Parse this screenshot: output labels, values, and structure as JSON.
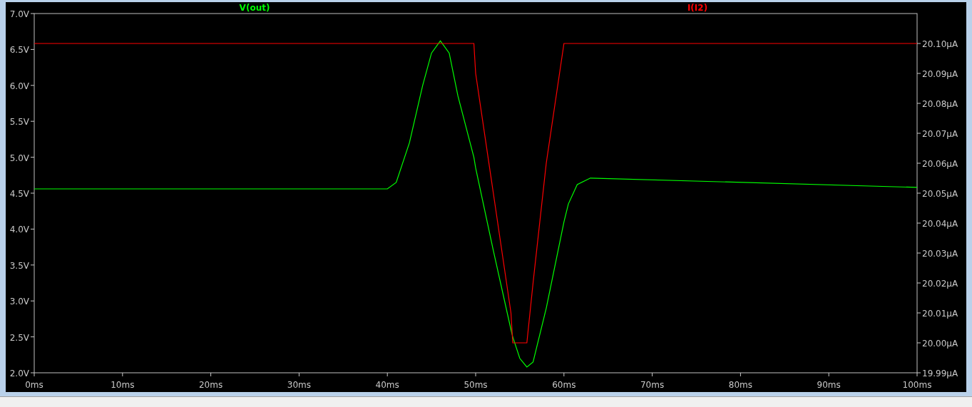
{
  "plot": {
    "chart_data": {
      "type": "line",
      "x": [
        0,
        40,
        41,
        42.5,
        44,
        45,
        46,
        47,
        48,
        49.8,
        50,
        52,
        54,
        54.2,
        55,
        55.8,
        56.5,
        58,
        59.5,
        60,
        60.5,
        61.5,
        63,
        100
      ],
      "xlim": [
        0,
        100
      ],
      "xticks": [
        {
          "value": 0,
          "label": "0ms"
        },
        {
          "value": 10,
          "label": "10ms"
        },
        {
          "value": 20,
          "label": "20ms"
        },
        {
          "value": 30,
          "label": "30ms"
        },
        {
          "value": 40,
          "label": "40ms"
        },
        {
          "value": 50,
          "label": "50ms"
        },
        {
          "value": 60,
          "label": "60ms"
        },
        {
          "value": 70,
          "label": "70ms"
        },
        {
          "value": 80,
          "label": "80ms"
        },
        {
          "value": 90,
          "label": "90ms"
        },
        {
          "value": 100,
          "label": "100ms"
        }
      ],
      "ylim": [
        2.0,
        7.0
      ],
      "yticks": [
        {
          "value": 2.0,
          "label": "2.0V"
        },
        {
          "value": 2.5,
          "label": "2.5V"
        },
        {
          "value": 3.0,
          "label": "3.0V"
        },
        {
          "value": 3.5,
          "label": "3.5V"
        },
        {
          "value": 4.0,
          "label": "4.0V"
        },
        {
          "value": 4.5,
          "label": "4.5V"
        },
        {
          "value": 5.0,
          "label": "5.0V"
        },
        {
          "value": 5.5,
          "label": "5.5V"
        },
        {
          "value": 6.0,
          "label": "6.0V"
        },
        {
          "value": 6.5,
          "label": "6.5V"
        },
        {
          "value": 7.0,
          "label": "7.0V"
        }
      ],
      "y2lim": [
        19.99,
        20.11
      ],
      "y2ticks": [
        {
          "value": 19.99,
          "label": "19.99µA"
        },
        {
          "value": 20.0,
          "label": "20.00µA"
        },
        {
          "value": 20.01,
          "label": "20.01µA"
        },
        {
          "value": 20.02,
          "label": "20.02µA"
        },
        {
          "value": 20.03,
          "label": "20.03µA"
        },
        {
          "value": 20.04,
          "label": "20.04µA"
        },
        {
          "value": 20.05,
          "label": "20.05µA"
        },
        {
          "value": 20.06,
          "label": "20.06µA"
        },
        {
          "value": 20.07,
          "label": "20.07µA"
        },
        {
          "value": 20.08,
          "label": "20.08µA"
        },
        {
          "value": 20.09,
          "label": "20.09µA"
        },
        {
          "value": 20.1,
          "label": "20.10µA"
        }
      ],
      "series": [
        {
          "name": "V(out)",
          "color": "#00ff00",
          "values": [
            4.56,
            4.56,
            4.65,
            5.2,
            6.0,
            6.45,
            6.62,
            6.45,
            5.85,
            5.0,
            4.85,
            3.7,
            2.6,
            2.5,
            2.2,
            2.08,
            2.15,
            2.9,
            3.8,
            4.1,
            4.35,
            4.62,
            4.71,
            4.58
          ]
        },
        {
          "name": "I(I2)",
          "color": "#ff0000",
          "axis": "y2",
          "values": [
            20.1,
            20.1,
            20.1,
            20.1,
            20.1,
            20.1,
            20.1,
            20.1,
            20.1,
            20.1,
            20.09,
            20.05,
            20.01,
            20.0,
            20.0,
            20.0,
            20.02,
            20.06,
            20.09,
            20.1,
            20.1,
            20.1,
            20.1,
            20.1
          ]
        }
      ]
    }
  }
}
